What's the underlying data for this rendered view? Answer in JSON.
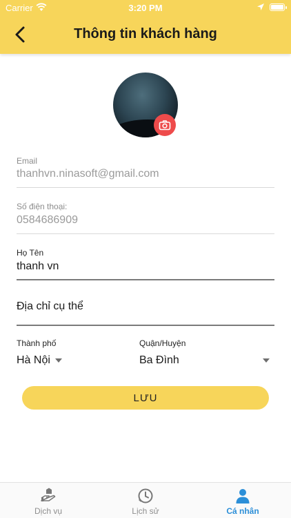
{
  "status_bar": {
    "carrier": "Carrier",
    "time": "3:20 PM"
  },
  "header": {
    "title": "Thông tin khách hàng",
    "background_color": "#F7D55A"
  },
  "profile": {
    "avatar_icon": "camera-icon",
    "camera_button_color": "#EE4B4B"
  },
  "form": {
    "email": {
      "label": "Email",
      "value": "thanhvn.ninasoft@gmail.com"
    },
    "phone": {
      "label": "Số điện thoại:",
      "value": "0584686909"
    },
    "name": {
      "label": "Họ Tên",
      "value": "thanh vn"
    },
    "address": {
      "placeholder": "Địa chỉ cụ thể",
      "value": ""
    },
    "city": {
      "label": "Thành phố",
      "value": "Hà Nội"
    },
    "district": {
      "label": "Quận/Huyện",
      "value": "Ba Đình"
    },
    "save_label": "LƯU"
  },
  "tabbar": {
    "active_color": "#2c8fd8",
    "tabs": [
      {
        "label": "Dịch vụ",
        "icon": "service-hand-icon"
      },
      {
        "label": "Lịch sử",
        "icon": "history-clock-icon"
      },
      {
        "label": "Cá nhân",
        "icon": "person-icon",
        "active": true
      }
    ]
  }
}
